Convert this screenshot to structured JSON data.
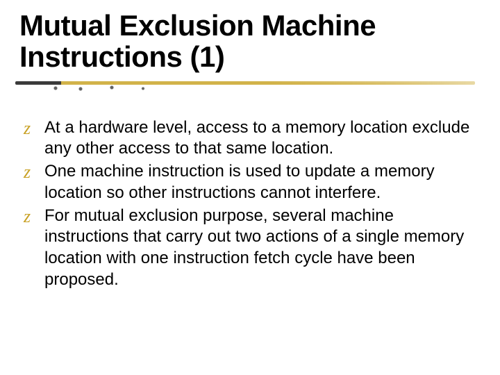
{
  "slide": {
    "title": "Mutual Exclusion Machine Instructions (1)",
    "bullets": [
      {
        "marker": "z",
        "text": "At a hardware level, access to a memory location exclude any other access to that same location."
      },
      {
        "marker": "z",
        "text": "One machine instruction is used to update a memory location so other instructions cannot interfere."
      },
      {
        "marker": "z",
        "text": "For mutual exclusion purpose, several machine instructions that  carry out two actions of a single memory location with one instruction fetch cycle have been proposed."
      }
    ]
  }
}
